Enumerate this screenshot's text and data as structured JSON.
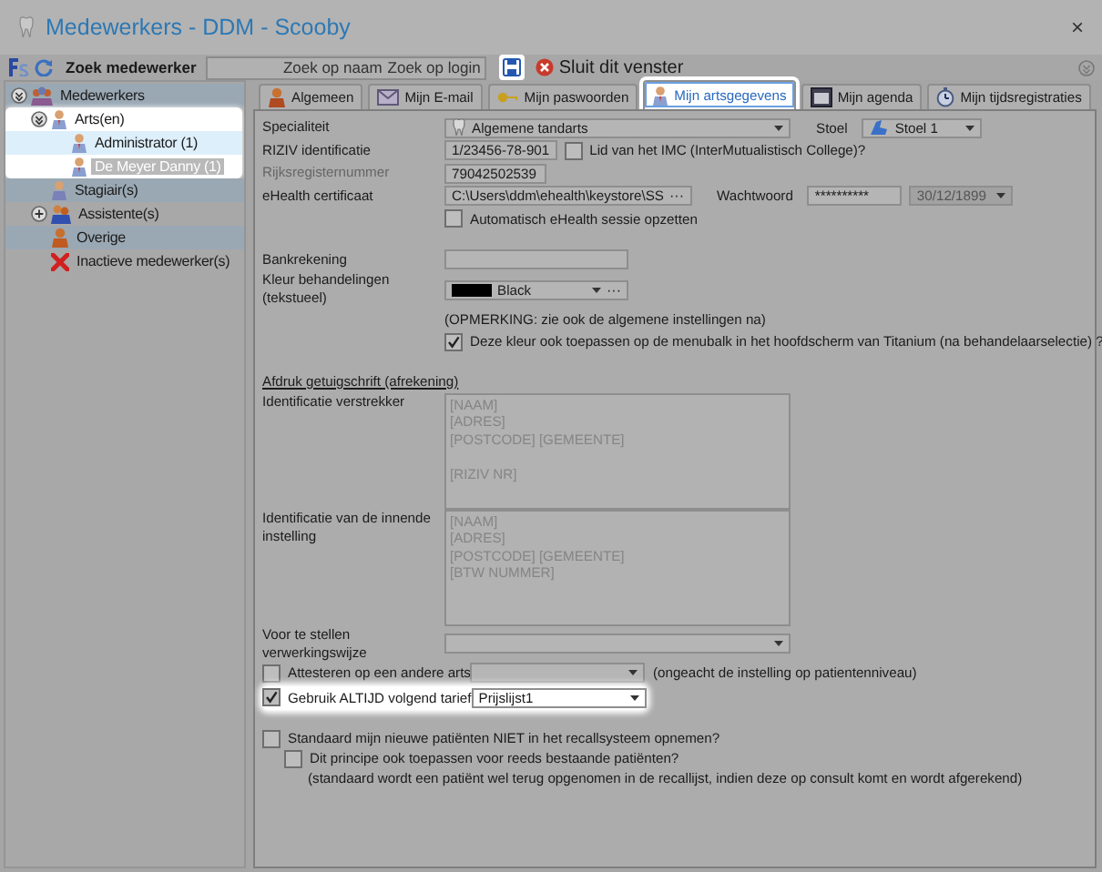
{
  "window": {
    "title": "Medewerkers - DDM - Scooby",
    "close": "×"
  },
  "toolbar": {
    "search_label": "Zoek medewerker",
    "search_buttons": [
      "Zoek op naam",
      "Zoek op login"
    ],
    "save_highlighted": true,
    "close_label": "Sluit dit venster"
  },
  "tree": [
    {
      "label": "Medewerkers",
      "kind": "group",
      "expanded": true,
      "selected": false,
      "children": [
        {
          "label": "Arts(en)",
          "kind": "doctor",
          "expanded": true,
          "selected": false,
          "highlighted": true,
          "children": [
            {
              "label": "Administrator (1)",
              "kind": "doctor",
              "selected": false
            },
            {
              "label": "De Meyer Danny (1)",
              "kind": "doctor",
              "selected": true
            }
          ]
        },
        {
          "label": "Stagiair(s)",
          "kind": "trainee",
          "selected": false
        },
        {
          "label": "Assistente(s)",
          "kind": "assistant",
          "expanded": false,
          "selected": false
        },
        {
          "label": "Overige",
          "kind": "other",
          "selected": false
        },
        {
          "label": "Inactieve medewerker(s)",
          "kind": "inactive",
          "selected": false
        }
      ]
    }
  ],
  "tabs": [
    {
      "label": "Algemeen",
      "kind": "person",
      "selected": false,
      "highlighted": false
    },
    {
      "label": "Mijn E-mail",
      "kind": "mail",
      "selected": false,
      "highlighted": false
    },
    {
      "label": "Mijn paswoorden",
      "kind": "key",
      "selected": false,
      "highlighted": false
    },
    {
      "label": "Mijn artsgegevens",
      "kind": "doctor",
      "selected": true,
      "highlighted": true
    },
    {
      "label": "Mijn agenda",
      "kind": "calendar",
      "selected": false,
      "highlighted": false
    },
    {
      "label": "Mijn tijdsregistraties",
      "kind": "clock",
      "selected": false,
      "highlighted": false
    }
  ],
  "form": {
    "rows": [
      {
        "kind": "field",
        "label": "Specialiteit",
        "disabled": false,
        "controls": [
          {
            "kind": "dropdown",
            "value": "Algemene tandarts",
            "disabled": false
          },
          {
            "kind": "label",
            "text": "Stoel"
          },
          {
            "kind": "dropdown",
            "value": "Stoel 1",
            "disabled": false
          }
        ]
      },
      {
        "kind": "field",
        "label": "RIZIV identificatie",
        "disabled": false,
        "controls": [
          {
            "kind": "input",
            "value": "1/23456-78-901"
          },
          {
            "kind": "checkbox",
            "label": "Lid van het IMC (InterMutualistisch College)?",
            "checked": false
          }
        ]
      },
      {
        "kind": "field",
        "label": "Rijksregisternummer",
        "disabled": true,
        "controls": [
          {
            "kind": "input",
            "value": "79042502539"
          }
        ]
      },
      {
        "kind": "field",
        "label": "eHealth certificaat",
        "disabled": false,
        "controls": [
          {
            "kind": "browse",
            "value": "C:\\Users\\ddm\\ehealth\\keystore\\SS",
            "button": "···"
          },
          {
            "kind": "label",
            "text": "Wachtwoord"
          },
          {
            "kind": "input",
            "value": "**********"
          },
          {
            "kind": "dropdown",
            "value": "30/12/1899",
            "disabled": true
          }
        ]
      },
      {
        "kind": "option",
        "controls": [
          {
            "kind": "checkbox",
            "label": "Automatisch eHealth sessie opzetten",
            "checked": false
          }
        ]
      },
      {
        "kind": "field",
        "label": "Bankrekening",
        "disabled": false,
        "controls": [
          {
            "kind": "input"
          }
        ]
      },
      {
        "kind": "field",
        "label": "Kleur behandelingen (tekstueel)",
        "disabled": false,
        "controls": [
          {
            "kind": "color",
            "value": "Black",
            "color": "#000000",
            "button": "···"
          }
        ]
      },
      {
        "kind": "option",
        "controls": [
          {
            "kind": "note",
            "text": "(OPMERKING: zie ook de algemene instellingen na)"
          }
        ]
      },
      {
        "kind": "option",
        "controls": [
          {
            "kind": "checkbox",
            "label": "Deze kleur ook toepassen op de menubalk in het hoofdscherm van Titanium (na behandelaarselectie) ?",
            "checked": true
          }
        ]
      },
      {
        "kind": "section",
        "label": "Afdruk getuigschrift (afrekening)"
      },
      {
        "kind": "field",
        "label": "Identificatie verstrekker",
        "disabled": false,
        "controls": [
          {
            "kind": "textarea",
            "paragraphs": [
              [
                "[NAAM]",
                "[ADRES]",
                "[POSTCODE] [GEMEENTE]"
              ],
              [
                "[RIZIV NR]"
              ]
            ]
          }
        ]
      },
      {
        "kind": "field",
        "label": "Identificatie van de innende instelling",
        "disabled": false,
        "controls": [
          {
            "kind": "textarea",
            "paragraphs": [
              [
                "[NAAM]",
                "[ADRES]",
                "[POSTCODE] [GEMEENTE]",
                "[BTW NUMMER]"
              ]
            ]
          }
        ]
      },
      {
        "kind": "field",
        "label": "Voor te stellen verwerkingswijze",
        "disabled": false,
        "controls": [
          {
            "kind": "dropdown",
            "disabled": false
          }
        ]
      },
      {
        "kind": "checkfield",
        "checkbox": {
          "label": "Attesteren op een andere arts",
          "checked": false
        },
        "controls": [
          {
            "kind": "dropdown",
            "disabled": false
          },
          {
            "kind": "note",
            "text": "(ongeacht de instelling op patientenniveau)"
          }
        ]
      },
      {
        "kind": "checkfield",
        "highlighted": true,
        "checkbox": {
          "label": "Gebruik ALTIJD volgend tarief",
          "checked": true
        },
        "controls": [
          {
            "kind": "dropdown",
            "value": "Prijslijst1",
            "disabled": false
          }
        ]
      },
      {
        "kind": "line",
        "checkbox": {
          "label": "Standaard mijn nieuwe patiënten NIET in het recallsysteem opnemen?",
          "checked": false
        },
        "children": [
          {
            "kind": "checkbox",
            "label": "Dit principe ook toepassen voor reeds bestaande patiënten?",
            "checked": false
          },
          {
            "kind": "note",
            "text": "(standaard wordt een patiënt wel terug opgenomen in de recallijst, indien deze op consult komt en wordt afgerekend)"
          }
        ]
      }
    ]
  }
}
